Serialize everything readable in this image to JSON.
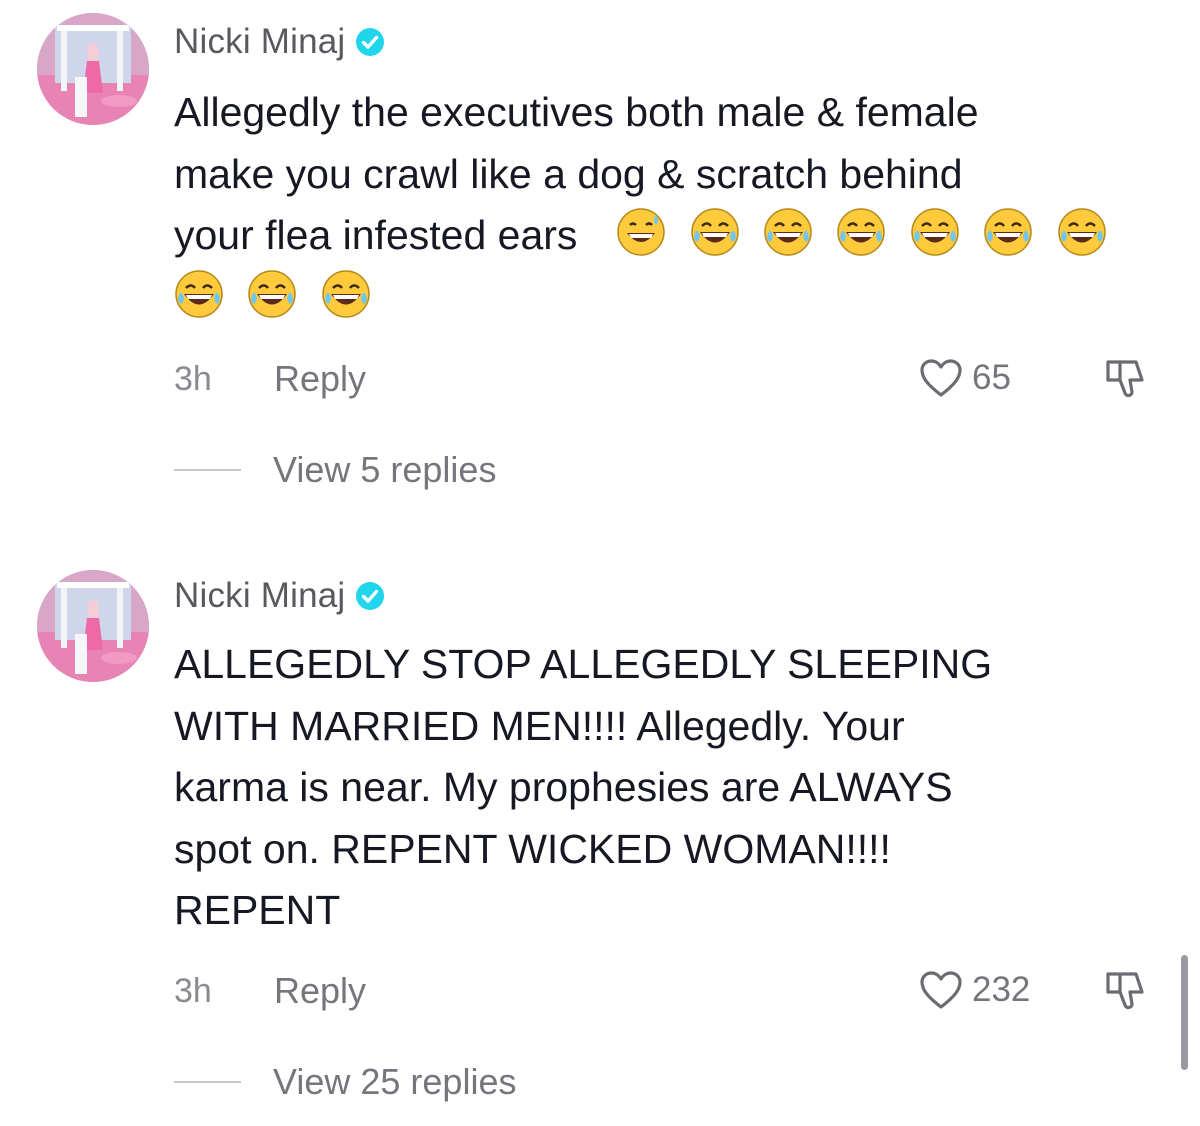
{
  "comments": [
    {
      "username": "Nicki Minaj",
      "verified": true,
      "text_lines": [
        "Allegedly the executives both male & female",
        "make you crawl like a dog & scratch behind",
        "your flea infested ears"
      ],
      "emojis_line3": [
        "grinning-sweat-emoji",
        "tears-of-joy-emoji",
        "tears-of-joy-emoji",
        "tears-of-joy-emoji",
        "tears-of-joy-emoji",
        "tears-of-joy-emoji",
        "tears-of-joy-emoji"
      ],
      "emojis_line4": [
        "tears-of-joy-emoji",
        "tears-of-joy-emoji",
        "tears-of-joy-emoji"
      ],
      "time": "3h",
      "reply_label": "Reply",
      "likes": "65",
      "view_replies": "View 5 replies"
    },
    {
      "username": "Nicki Minaj",
      "verified": true,
      "text_lines": [
        "ALLEGEDLY STOP ALLEGEDLY SLEEPING",
        "WITH MARRIED MEN!!!! Allegedly. Your",
        "karma is near. My prophesies are ALWAYS",
        "spot on. REPENT WICKED WOMAN!!!!",
        "REPENT"
      ],
      "time": "3h",
      "reply_label": "Reply",
      "likes": "232",
      "view_replies": "View 25 replies"
    }
  ],
  "colors": {
    "verified": "#20d5ec",
    "text": "#161823",
    "secondary": "#75767c"
  },
  "icons": {
    "like": "heart-outline-icon",
    "dislike": "thumbs-down-icon",
    "verified": "verified-check-icon"
  }
}
